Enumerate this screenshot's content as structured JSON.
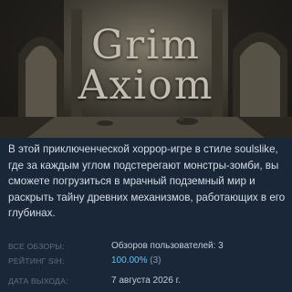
{
  "capsule": {
    "title_line1": "Grim",
    "title_line2": "Axiom"
  },
  "description": "В этой приключенческой хоррор-игре в стиле soulslike, где за каждым углом подстерегают монстры-зомби, вы сможете погрузиться в мрачный подземный мир и раскрыть тайну древних механизмов, работающих в его глубинах.",
  "reviews": {
    "all_label": "ВСЕ ОБЗОРЫ:",
    "all_value": "Обзоров пользователей: 3",
    "rating_label": "РЕЙТИНГ SIH:",
    "rating_percent": "100.00%",
    "rating_count": "(3)"
  },
  "release": {
    "label": "ДАТА ВЫХОДА:",
    "value": "7 августа 2026 г."
  },
  "colors": {
    "background": "#1a2738",
    "text": "#d6dde6",
    "label": "#5d6f86",
    "positive": "#66c0f4"
  }
}
